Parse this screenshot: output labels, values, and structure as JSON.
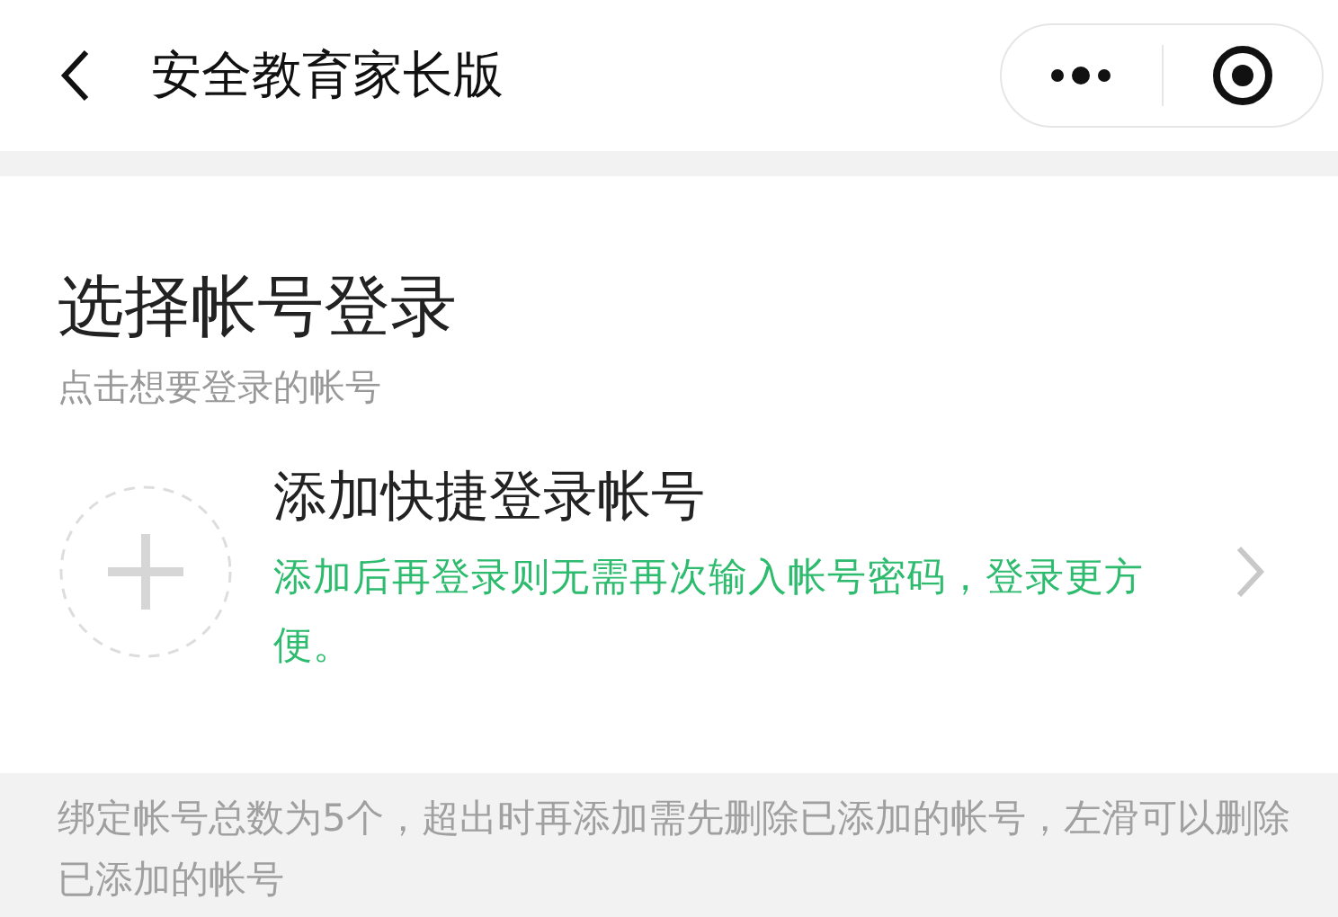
{
  "nav": {
    "title": "安全教育家长版"
  },
  "heading": "选择帐号登录",
  "subheading": "点击想要登录的帐号",
  "add_account": {
    "title": "添加快捷登录帐号",
    "description": "添加后再登录则无需再次输入帐号密码，登录更方便。"
  },
  "footer_note": "绑定帐号总数为5个，超出时再添加需先删除已添加的帐号，左滑可以删除已添加的帐号"
}
